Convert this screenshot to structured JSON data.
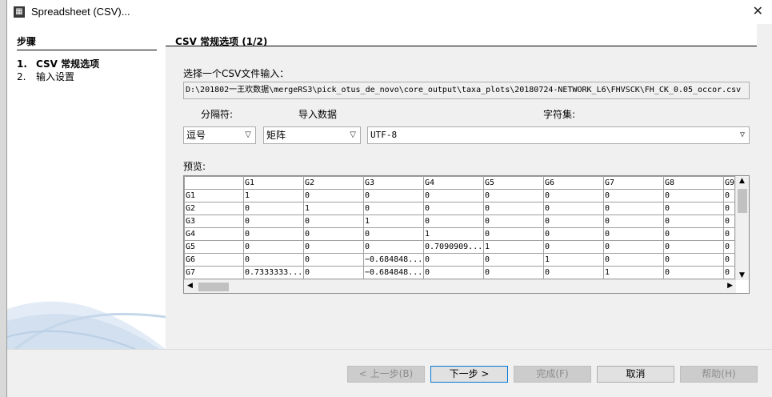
{
  "window": {
    "title": "Spreadsheet (CSV)..."
  },
  "steps": {
    "header": "步骤",
    "items": [
      {
        "num": "1.",
        "label": "CSV 常规选项",
        "active": true
      },
      {
        "num": "2.",
        "label": "输入设置",
        "active": false
      }
    ]
  },
  "main": {
    "header": "CSV 常规选项 (1/2)",
    "file_label": "选择一个CSV文件输入：",
    "file_path": "D:\\201802一王欢数据\\mergeRS3\\pick_otus_de_novo\\core_output\\taxa_plots\\20180724-NETWORK_L6\\FHVSCK\\FH_CK_0.05_occor.csv",
    "separator_label": "分隔符:",
    "import_label": "导入数据",
    "charset_label": "字符集:",
    "separator_value": "逗号",
    "import_value": "矩阵",
    "charset_value": "UTF-8",
    "preview_label": "预览:",
    "preview": {
      "header": [
        "",
        "G1",
        "G2",
        "G3",
        "G4",
        "G5",
        "G6",
        "G7",
        "G8",
        "G9"
      ],
      "rows": [
        [
          "G1",
          "1",
          "0",
          "0",
          "0",
          "0",
          "0",
          "0",
          "0",
          "0"
        ],
        [
          "G2",
          "0",
          "1",
          "0",
          "0",
          "0",
          "0",
          "0",
          "0",
          "0"
        ],
        [
          "G3",
          "0",
          "0",
          "1",
          "0",
          "0",
          "0",
          "0",
          "0",
          "0"
        ],
        [
          "G4",
          "0",
          "0",
          "0",
          "1",
          "0",
          "0",
          "0",
          "0",
          "0"
        ],
        [
          "G5",
          "0",
          "0",
          "0",
          "0.7090909...",
          "1",
          "0",
          "0",
          "0",
          "0"
        ],
        [
          "G6",
          "0",
          "0",
          "−0.684848...",
          "0",
          "0",
          "1",
          "0",
          "0",
          "0"
        ],
        [
          "G7",
          "0.7333333...",
          "0",
          "−0.684848...",
          "0",
          "0",
          "0",
          "1",
          "0",
          "0"
        ]
      ]
    }
  },
  "buttons": {
    "prev": "< 上一步(B)",
    "next": "下一步 >",
    "finish": "完成(F)",
    "cancel": "取消",
    "help": "帮助(H)"
  },
  "icons": {
    "app": "spreadsheet-app-icon",
    "close": "close-icon",
    "dropdown": "chevron-down-icon"
  }
}
